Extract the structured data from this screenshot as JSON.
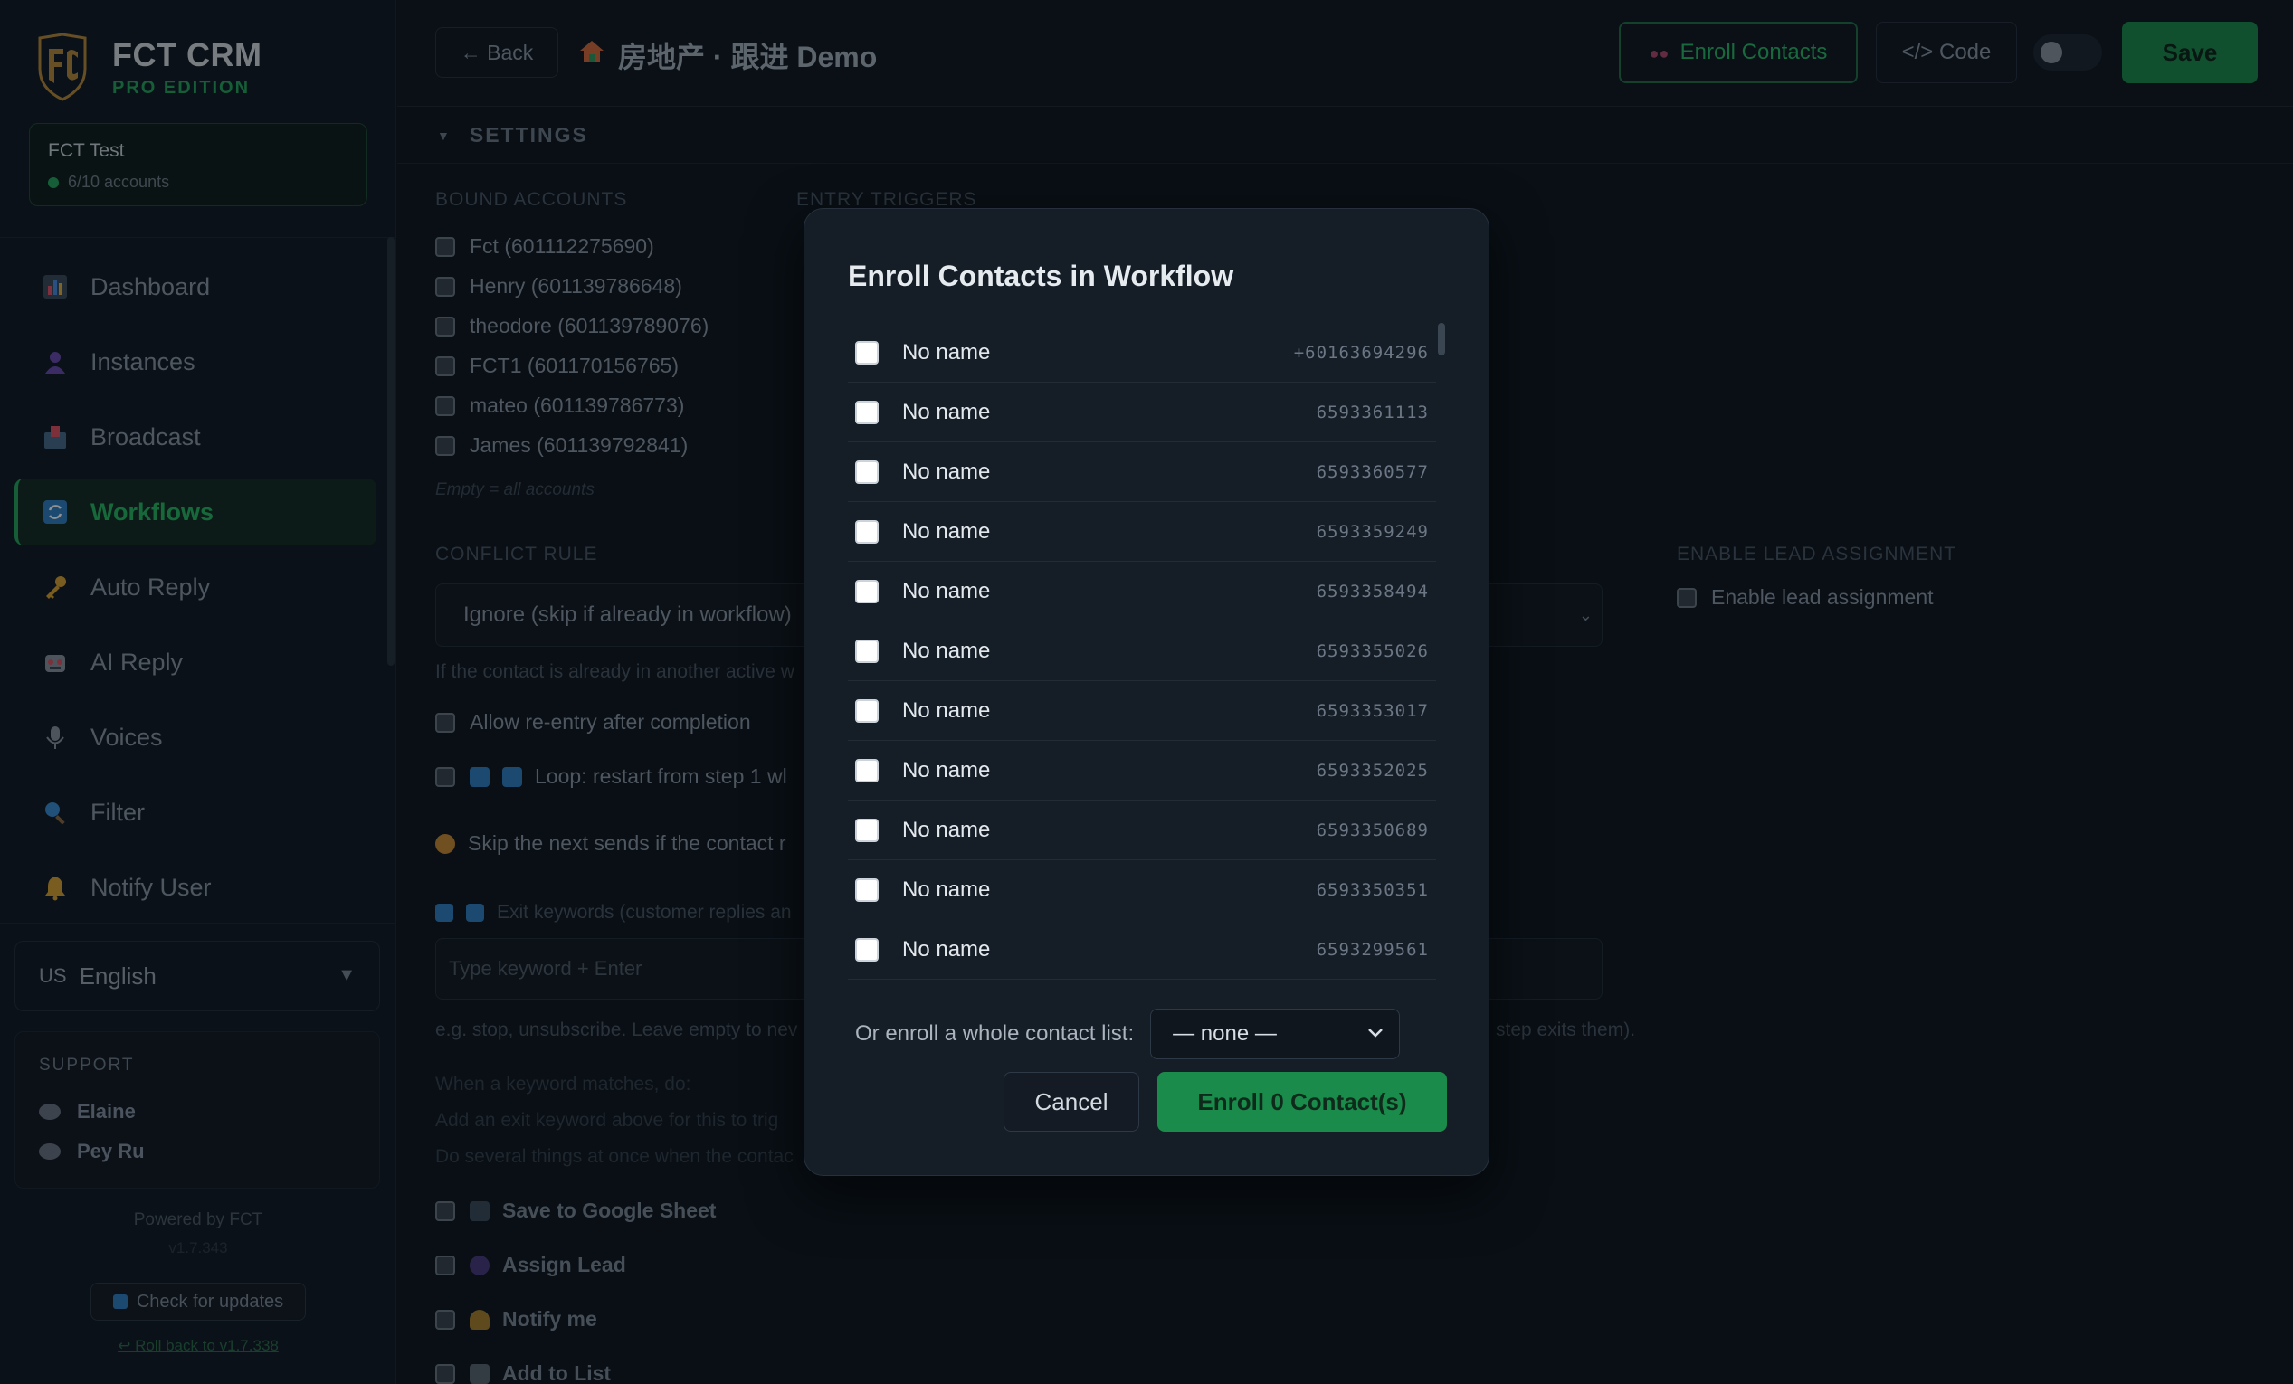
{
  "brand": {
    "name": "FCT CRM",
    "edition": "PRO EDITION"
  },
  "account": {
    "name": "FCT Test",
    "count": "6/10 accounts"
  },
  "nav": [
    {
      "label": "Dashboard",
      "icon": "chart-icon"
    },
    {
      "label": "Instances",
      "icon": "user-icon"
    },
    {
      "label": "Broadcast",
      "icon": "inbox-icon"
    },
    {
      "label": "Workflows",
      "icon": "refresh-icon",
      "active": true
    },
    {
      "label": "Auto Reply",
      "icon": "key-icon"
    },
    {
      "label": "AI Reply",
      "icon": "robot-icon"
    },
    {
      "label": "Voices",
      "icon": "microphone-icon"
    },
    {
      "label": "Filter",
      "icon": "magnifier-icon"
    },
    {
      "label": "Notify User",
      "icon": "bell-icon"
    }
  ],
  "language": {
    "flag": "US",
    "label": "English"
  },
  "support": {
    "title": "SUPPORT",
    "contacts": [
      "Elaine",
      "Pey Ru"
    ]
  },
  "footer": {
    "powered": "Powered by FCT",
    "version": "v1.7.343",
    "update": "Check for updates",
    "rollback": "↩ Roll back to v1.7.338"
  },
  "topbar": {
    "back": "← Back",
    "title": "房地产 · 跟进 Demo",
    "enroll": "Enroll Contacts",
    "code": "</> Code",
    "save": "Save"
  },
  "settings": {
    "heading": "SETTINGS",
    "bound_accounts_label": "BOUND ACCOUNTS",
    "entry_triggers_label": "ENTRY TRIGGERS",
    "accounts": [
      "Fct (601112275690)",
      "Henry (601139786648)",
      "theodore (601139789076)",
      "FCT1 (601170156765)",
      "mateo (601139786773)",
      "James (601139792841)"
    ],
    "accounts_hint": "Empty = all accounts",
    "conflict_label": "CONFLICT RULE",
    "conflict_value": "Ignore (skip if already in workflow)",
    "conflict_hint": "If the contact is already in another active w",
    "lead_label": "ENABLE LEAD ASSIGNMENT",
    "lead_checkbox": "Enable lead assignment",
    "reentry": "Allow re-entry after completion",
    "loop": "Loop: restart from step 1 wl",
    "skip": "Skip the next sends if the contact r",
    "exit_keywords": "Exit keywords (customer replies an",
    "keyword_placeholder": "Type keyword + Enter",
    "keyword_hint_left": "e.g. stop, unsubscribe. Leave empty to nev",
    "keyword_hint_right": "step exits them).",
    "when_match": "When a keyword matches, do:",
    "add_exit_hint": "Add an exit keyword above for this to trig",
    "several": "Do several things at once when the contac",
    "actions": [
      "Save to Google Sheet",
      "Assign Lead",
      "Notify me",
      "Add to List"
    ]
  },
  "modal": {
    "title": "Enroll Contacts in Workflow",
    "contacts": [
      {
        "name": "No name",
        "phone": "+60163694296"
      },
      {
        "name": "No name",
        "phone": "6593361113"
      },
      {
        "name": "No name",
        "phone": "6593360577"
      },
      {
        "name": "No name",
        "phone": "6593359249"
      },
      {
        "name": "No name",
        "phone": "6593358494"
      },
      {
        "name": "No name",
        "phone": "6593355026"
      },
      {
        "name": "No name",
        "phone": "6593353017"
      },
      {
        "name": "No name",
        "phone": "6593352025"
      },
      {
        "name": "No name",
        "phone": "6593350689"
      },
      {
        "name": "No name",
        "phone": "6593350351"
      },
      {
        "name": "No name",
        "phone": "6593299561"
      }
    ],
    "list_label": "Or enroll a whole contact list:",
    "list_value": "— none —",
    "cancel": "Cancel",
    "enroll": "Enroll 0 Contact(s)"
  },
  "colors": {
    "accent": "#23a55a",
    "background": "#0e141c",
    "modal": "#151d27"
  }
}
